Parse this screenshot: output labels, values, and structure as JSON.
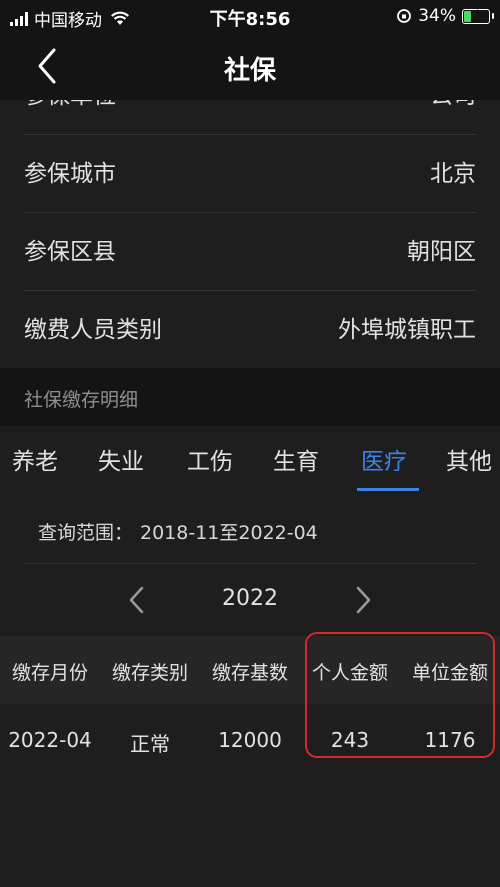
{
  "status_bar": {
    "carrier": "中国移动",
    "time": "下午8:56",
    "battery": "34%",
    "battery_level": 0.34
  },
  "nav": {
    "title": "社保"
  },
  "info": [
    {
      "label": "参保单位",
      "value": "公司"
    },
    {
      "label": "参保城市",
      "value": "北京"
    },
    {
      "label": "参保区县",
      "value": "朝阳区"
    },
    {
      "label": "缴费人员类别",
      "value": "外埠城镇职工"
    }
  ],
  "section": {
    "title": "社保缴存明细"
  },
  "tabs": [
    "养老",
    "失业",
    "工伤",
    "生育",
    "医疗",
    "其他"
  ],
  "active_tab": "医疗",
  "query": {
    "label": "查询范围：",
    "range": "2018-11至2022-04"
  },
  "year": "2022",
  "table": {
    "headers": [
      "缴存月份",
      "缴存类别",
      "缴存基数",
      "个人金额",
      "单位金额"
    ],
    "rows": [
      [
        "2022-04",
        "正常",
        "12000",
        "243",
        "1176"
      ]
    ]
  },
  "colors": {
    "accent": "#3e82e8",
    "highlight": "#d42a2a",
    "battery": "#4cd964"
  }
}
